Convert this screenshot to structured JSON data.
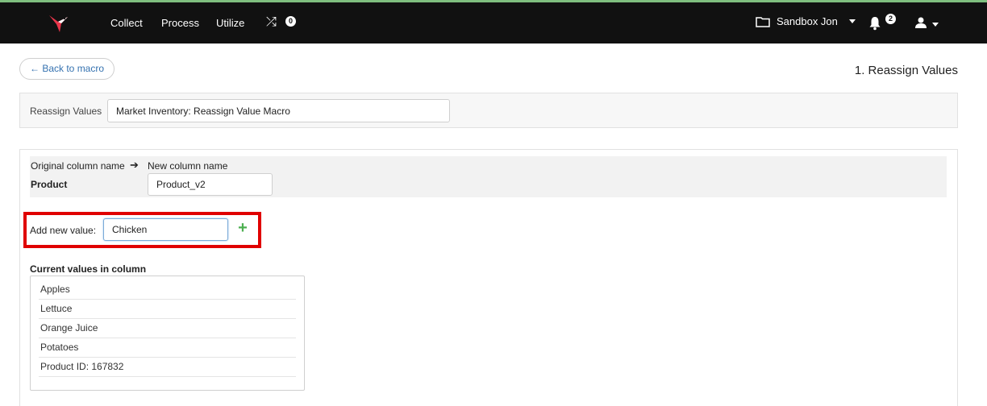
{
  "nav": {
    "items": [
      "Collect",
      "Process",
      "Utilize"
    ],
    "shuffle_count": "0",
    "workspace": "Sandbox Jon",
    "notification_count": "2"
  },
  "header": {
    "back_label": "← Back to macro",
    "step_title": "1. Reassign Values"
  },
  "macro": {
    "name_label": "Reassign Values",
    "name_value": "Market Inventory: Reassign Value Macro"
  },
  "column": {
    "original_label": "Original column name",
    "new_label": "New column name",
    "original_value": "Product",
    "new_value": "Product_v2"
  },
  "add_value": {
    "label": "Add new value:",
    "value": "Chicken"
  },
  "current_values": {
    "title": "Current values in column",
    "items": [
      "Apples",
      "Lettuce",
      "Orange Juice",
      "Potatoes",
      "Product ID: 167832"
    ]
  },
  "colors": {
    "nav_bg": "#111111",
    "highlight": "#e00000",
    "add_button": "#4caf50",
    "link": "#3572b0"
  }
}
